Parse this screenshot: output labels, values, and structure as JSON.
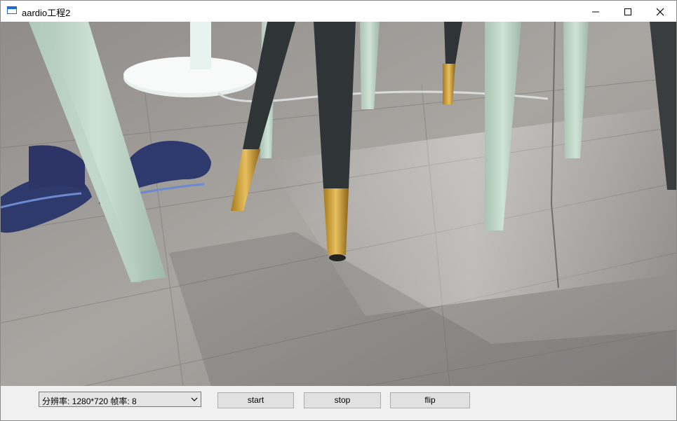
{
  "window": {
    "title": "aardio工程2",
    "icon": "app-window-icon",
    "controls": [
      "minimize-icon",
      "maximize-icon",
      "close-icon"
    ]
  },
  "camera": {
    "resolution_label": "分辨率: 1280*720 帧率: 8"
  },
  "buttons": {
    "start": "start",
    "stop": "stop",
    "flip": "flip"
  }
}
